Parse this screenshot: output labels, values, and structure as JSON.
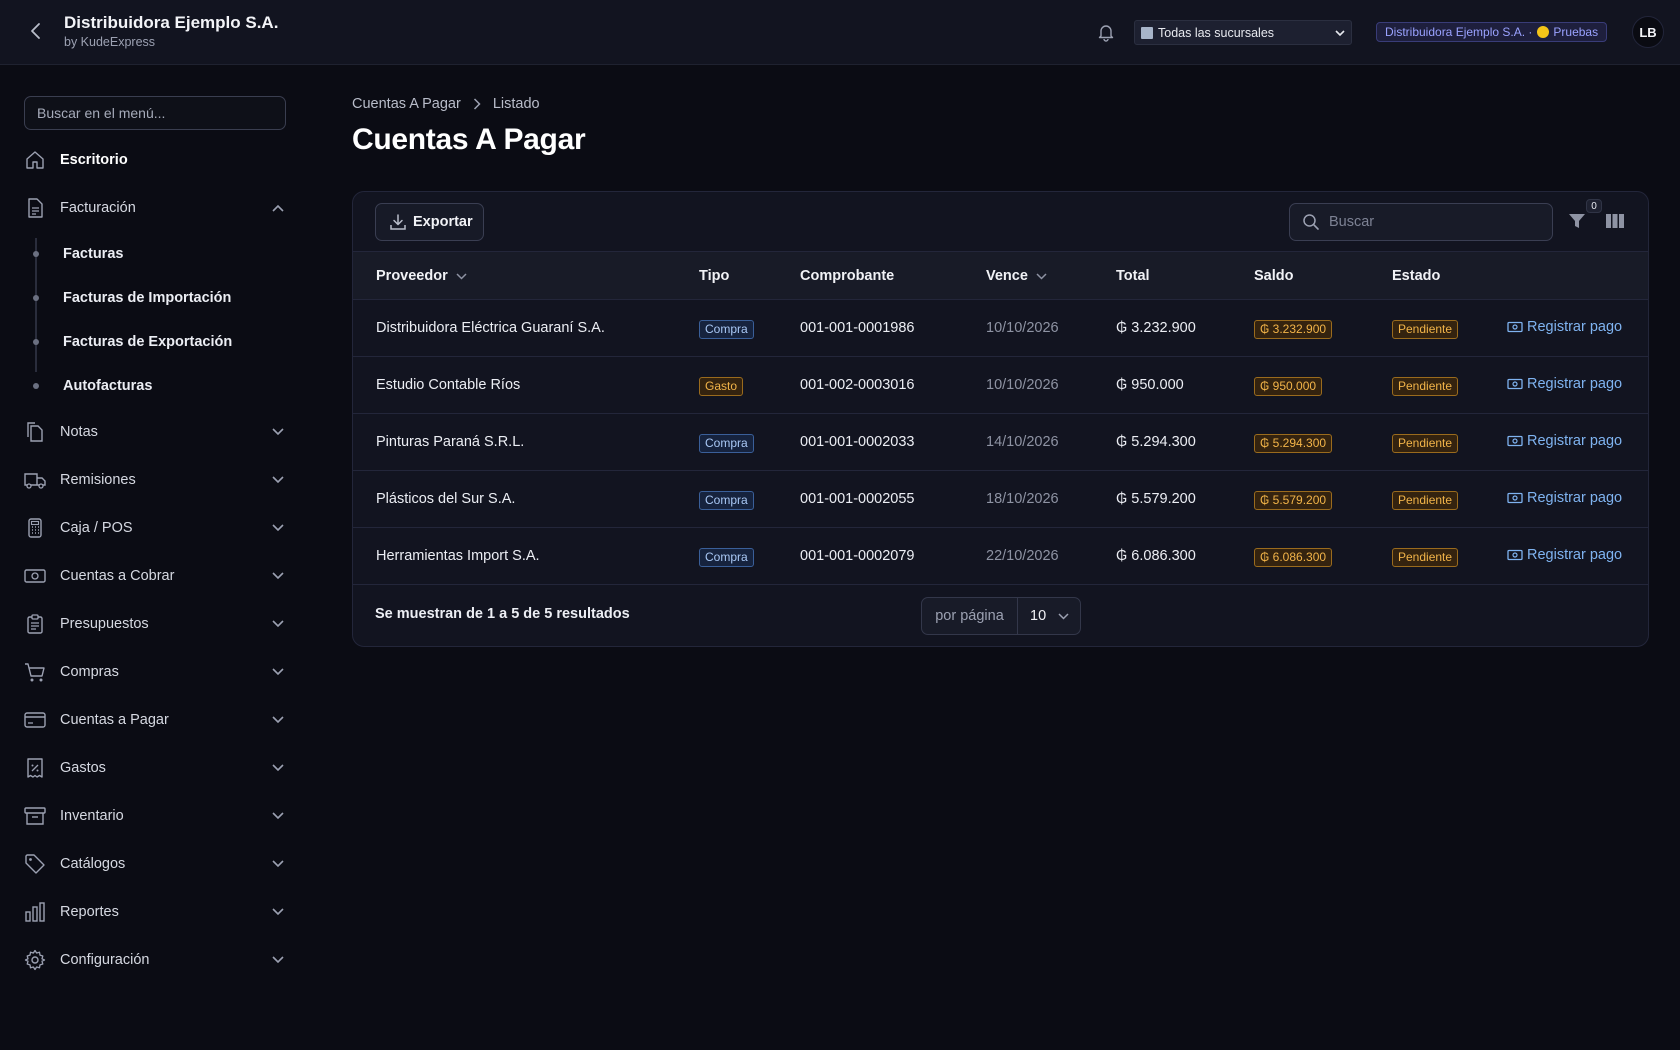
{
  "header": {
    "back_icon": "chevron-left-icon",
    "title": "Distribuidora Ejemplo S.A.",
    "subtitle": "by KudeExpress",
    "branch_select": "Todas las sucursales",
    "company_badge": "Distribuidora Ejemplo S.A. ·",
    "environment": "Pruebas",
    "avatar_initials": "LB"
  },
  "sidebar": {
    "search_placeholder": "Buscar en el menú...",
    "items": [
      {
        "label": "Escritorio",
        "icon": "home-icon"
      },
      {
        "label": "Facturación",
        "icon": "document-icon"
      },
      {
        "label": "Notas",
        "icon": "documents-icon"
      },
      {
        "label": "Remisiones",
        "icon": "truck-icon"
      },
      {
        "label": "Caja / POS",
        "icon": "calculator-icon"
      },
      {
        "label": "Cuentas a Cobrar",
        "icon": "banknote-icon"
      },
      {
        "label": "Presupuestos",
        "icon": "clipboard-icon"
      },
      {
        "label": "Compras",
        "icon": "cart-icon"
      },
      {
        "label": "Cuentas a Pagar",
        "icon": "credit-card-icon"
      },
      {
        "label": "Gastos",
        "icon": "receipt-percent-icon"
      },
      {
        "label": "Inventario",
        "icon": "archive-box-icon"
      },
      {
        "label": "Catálogos",
        "icon": "tag-icon"
      },
      {
        "label": "Reportes",
        "icon": "bar-chart-icon"
      },
      {
        "label": "Configuración",
        "icon": "gear-icon"
      }
    ],
    "facturacion_sub": [
      "Facturas",
      "Facturas de Importación",
      "Facturas de Exportación",
      "Autofacturas"
    ]
  },
  "breadcrumb": {
    "parent": "Cuentas A Pagar",
    "current": "Listado"
  },
  "page_title": "Cuentas A Pagar",
  "toolbar": {
    "export_label": "Exportar",
    "search_placeholder": "Buscar",
    "filter_count": "0"
  },
  "table": {
    "columns": [
      "Proveedor",
      "Tipo",
      "Comprobante",
      "Vence",
      "Total",
      "Saldo",
      "Estado"
    ],
    "rows": [
      {
        "proveedor": "Distribuidora Eléctrica Guaraní S.A.",
        "tipo": "Compra",
        "comprobante": "001-001-0001986",
        "vence": "10/10/2026",
        "total": "₲ 3.232.900",
        "saldo": "₲ 3.232.900",
        "estado": "Pendiente",
        "accion": "Registrar pago"
      },
      {
        "proveedor": "Estudio Contable Ríos",
        "tipo": "Gasto",
        "comprobante": "001-002-0003016",
        "vence": "10/10/2026",
        "total": "₲ 950.000",
        "saldo": "₲ 950.000",
        "estado": "Pendiente",
        "accion": "Registrar pago"
      },
      {
        "proveedor": "Pinturas Paraná S.R.L.",
        "tipo": "Compra",
        "comprobante": "001-001-0002033",
        "vence": "14/10/2026",
        "total": "₲ 5.294.300",
        "saldo": "₲ 5.294.300",
        "estado": "Pendiente",
        "accion": "Registrar pago"
      },
      {
        "proveedor": "Plásticos del Sur S.A.",
        "tipo": "Compra",
        "comprobante": "001-001-0002055",
        "vence": "18/10/2026",
        "total": "₲ 5.579.200",
        "saldo": "₲ 5.579.200",
        "estado": "Pendiente",
        "accion": "Registrar pago"
      },
      {
        "proveedor": "Herramientas Import S.A.",
        "tipo": "Compra",
        "comprobante": "001-001-0002079",
        "vence": "22/10/2026",
        "total": "₲ 6.086.300",
        "saldo": "₲ 6.086.300",
        "estado": "Pendiente",
        "accion": "Registrar pago"
      }
    ]
  },
  "footer": {
    "results_text": "Se muestran de 1 a 5 de 5 resultados",
    "per_page_label": "por página",
    "per_page_value": "10"
  },
  "colors": {
    "background": "#0b0c14",
    "surface": "#121420",
    "link": "#7fb3f0",
    "warning": "#f2b449",
    "info": "#a9c8f5",
    "badge_accent": "#9aa2ff"
  }
}
